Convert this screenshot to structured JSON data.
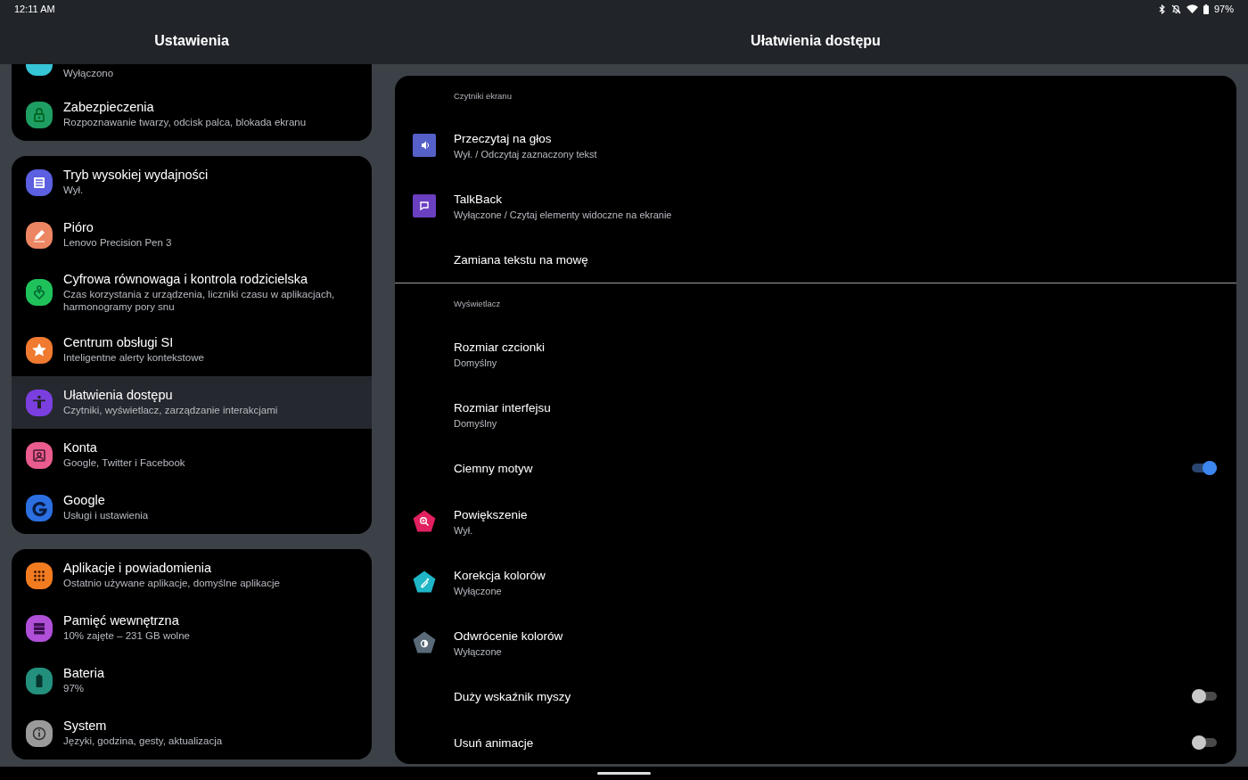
{
  "status_bar": {
    "time": "12:11 AM",
    "battery": "97%"
  },
  "sidebar": {
    "title": "Ustawienia",
    "groups": [
      {
        "items": [
          {
            "subtitle": "Wyłączono",
            "color": "#36c5d6",
            "selected": false
          },
          {
            "title": "Zabezpieczenia",
            "subtitle": "Rozpoznawanie twarzy, odcisk palca, blokada ekranu",
            "color": "#1e9e62",
            "selected": false
          }
        ]
      },
      {
        "items": [
          {
            "title": "Tryb wysokiej wydajności",
            "subtitle": "Wył.",
            "color": "#5b5fe0",
            "selected": false
          },
          {
            "title": "Pióro",
            "subtitle": "Lenovo Precision Pen 3",
            "color": "#ec8662",
            "selected": false
          },
          {
            "title": "Cyfrowa równowaga i kontrola rodzicielska",
            "subtitle": "Czas korzystania z urządzenia, liczniki czasu w aplikacjach, harmonogramy pory snu",
            "color": "#1fc25a",
            "selected": false
          },
          {
            "title": "Centrum obsługi SI",
            "subtitle": "Inteligentne alerty kontekstowe",
            "color": "#f07a30",
            "selected": false
          },
          {
            "title": "Ułatwienia dostępu",
            "subtitle": "Czytniki, wyświetlacz, zarządzanie interakcjami",
            "color": "#7b3fe0",
            "selected": true
          },
          {
            "title": "Konta",
            "subtitle": "Google, Twitter i Facebook",
            "color": "#ea5c8e",
            "selected": false
          },
          {
            "title": "Google",
            "subtitle": "Usługi i ustawienia",
            "color": "#2b6fe0",
            "selected": false
          }
        ]
      },
      {
        "items": [
          {
            "title": "Aplikacje i powiadomienia",
            "subtitle": "Ostatnio używane aplikacje, domyślne aplikacje",
            "color": "#f47c20",
            "selected": false
          },
          {
            "title": "Pamięć wewnętrzna",
            "subtitle": "10% zajęte – 231 GB wolne",
            "color": "#b04fd8",
            "selected": false
          },
          {
            "title": "Bateria",
            "subtitle": "97%",
            "color": "#23907e",
            "selected": false
          },
          {
            "title": "System",
            "subtitle": "Języki, godzina, gesty, aktualizacja",
            "color": "#9a9a9a",
            "selected": false
          }
        ]
      }
    ]
  },
  "content": {
    "title": "Ułatwienia dostępu",
    "sections": [
      {
        "header": "Czytniki ekranu",
        "rows": [
          {
            "kind": "icon",
            "title": "Przeczytaj na głos",
            "subtitle": "Wył. / Odczytaj zaznaczony tekst",
            "color": "#5560c8"
          },
          {
            "kind": "icon",
            "title": "TalkBack",
            "subtitle": "Wyłączone / Czytaj elementy widoczne na ekranie",
            "color": "#6a3fc0"
          },
          {
            "kind": "plain",
            "title": "Zamiana tekstu na mowę"
          }
        ]
      },
      {
        "header": "Wyświetlacz",
        "rows": [
          {
            "kind": "plain",
            "title": "Rozmiar czcionki",
            "subtitle": "Domyślny"
          },
          {
            "kind": "plain",
            "title": "Rozmiar interfejsu",
            "subtitle": "Domyślny"
          },
          {
            "kind": "switch",
            "title": "Ciemny motyw",
            "on": true
          },
          {
            "kind": "icon",
            "title": "Powiększenie",
            "subtitle": "Wył.",
            "color": "#e0205f"
          },
          {
            "kind": "icon",
            "title": "Korekcja kolorów",
            "subtitle": "Wyłączone",
            "color": "#1fb6c8"
          },
          {
            "kind": "icon",
            "title": "Odwrócenie kolorów",
            "subtitle": "Wyłączone",
            "color": "#5a6a78"
          },
          {
            "kind": "switch",
            "title": "Duży wskaźnik myszy",
            "on": false
          },
          {
            "kind": "switch",
            "title": "Usuń animacje",
            "on": false
          }
        ]
      }
    ]
  }
}
